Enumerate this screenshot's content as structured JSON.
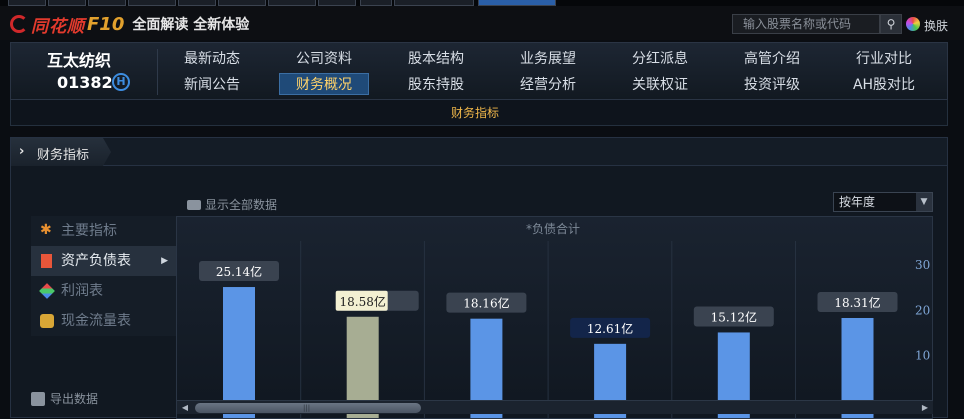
{
  "header": {
    "logo_text": "同花顺",
    "logo_f10": "F10",
    "slogan": "全面解读 全新体验",
    "search_placeholder": "输入股票名称或代码",
    "skin_label": "换肤"
  },
  "stock": {
    "name": "互太纺织",
    "code": "01382",
    "market_badge": "H"
  },
  "nav": {
    "row1": [
      "最新动态",
      "公司资料",
      "股本结构",
      "业务展望",
      "分红派息",
      "高管介绍",
      "行业对比"
    ],
    "row2": [
      "新闻公告",
      "财务概况",
      "股东持股",
      "经营分析",
      "关联权证",
      "投资评级",
      "AH股对比"
    ],
    "active": "财务概况",
    "sub_item": "财务指标"
  },
  "panel": {
    "title": "财务指标",
    "show_all": "显示全部数据",
    "period_select": "按年度",
    "side_menu": [
      {
        "label": "主要指标",
        "icon": "star-icon",
        "active": false
      },
      {
        "label": "资产负债表",
        "icon": "document-icon",
        "active": true
      },
      {
        "label": "利润表",
        "icon": "cube-icon",
        "active": false
      },
      {
        "label": "现金流量表",
        "icon": "coins-icon",
        "active": false
      }
    ],
    "export_label": "导出数据"
  },
  "chart_data": {
    "type": "bar",
    "title": "*负债合计",
    "values": [
      25.14,
      18.58,
      18.16,
      12.61,
      15.12,
      18.31
    ],
    "labels": [
      "25.14亿",
      "18.58亿",
      "18.16亿",
      "12.61亿",
      "15.12亿",
      "18.31亿"
    ],
    "y_ticks": [
      10,
      20,
      30
    ],
    "highlight_index": 1,
    "dark_label_index": 3,
    "bar_color": "#5b95e6",
    "highlight_bar_color": "#a7ad93"
  }
}
